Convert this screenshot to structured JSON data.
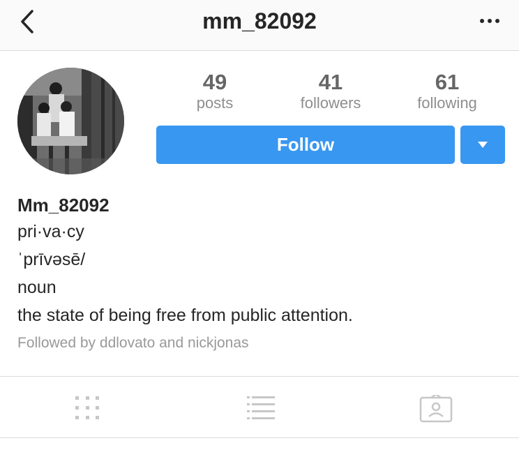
{
  "header": {
    "username": "mm_82092",
    "back_icon": "chevron-left-icon",
    "more_icon": "more-horizontal-icon"
  },
  "profile": {
    "avatar_alt": "profile-photo",
    "stats": [
      {
        "value": "49",
        "label": "posts"
      },
      {
        "value": "41",
        "label": "followers"
      },
      {
        "value": "61",
        "label": "following"
      }
    ],
    "follow_label": "Follow",
    "dropdown_icon": "caret-down-icon"
  },
  "bio": {
    "name": "Mm_82092",
    "lines": [
      "pri·va·cy",
      "ˈprīvəsē/",
      "noun",
      "the state of being free from public attention."
    ],
    "followed_by": "Followed by ddlovato and nickjonas"
  },
  "tabs": [
    {
      "icon": "grid-icon"
    },
    {
      "icon": "list-icon"
    },
    {
      "icon": "tagged-icon"
    }
  ],
  "colors": {
    "accent": "#3897f0",
    "text": "#262626",
    "muted": "#8e8e8e",
    "divider": "#dbdbdb",
    "tab_icon": "#c7c7c7"
  }
}
